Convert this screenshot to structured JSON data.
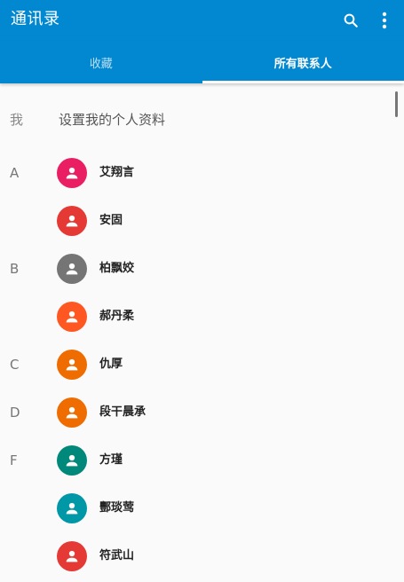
{
  "appbar": {
    "title": "通讯录",
    "search_icon": "search-icon",
    "more_icon": "more-vert-icon"
  },
  "tabs": [
    {
      "label": "收藏",
      "active": false
    },
    {
      "label": "所有联系人",
      "active": true
    }
  ],
  "profile": {
    "letter": "我",
    "text": "设置我的个人资料"
  },
  "contacts": [
    {
      "letter": "A",
      "name": "艾翔言",
      "color": "#e91e63"
    },
    {
      "letter": "",
      "name": "安固",
      "color": "#e53935"
    },
    {
      "letter": "B",
      "name": "柏飘姣",
      "color": "#757575"
    },
    {
      "letter": "",
      "name": "郝丹柔",
      "color": "#ff5722"
    },
    {
      "letter": "C",
      "name": "仇厚",
      "color": "#ef6c00"
    },
    {
      "letter": "D",
      "name": "段干晨承",
      "color": "#ef6c00"
    },
    {
      "letter": "F",
      "name": "方瑾",
      "color": "#00897b"
    },
    {
      "letter": "",
      "name": "酆琰莺",
      "color": "#0097a7"
    },
    {
      "letter": "",
      "name": "符武山",
      "color": "#e53935"
    }
  ],
  "colors": {
    "primary": "#0288d1",
    "background": "#fafafa"
  }
}
